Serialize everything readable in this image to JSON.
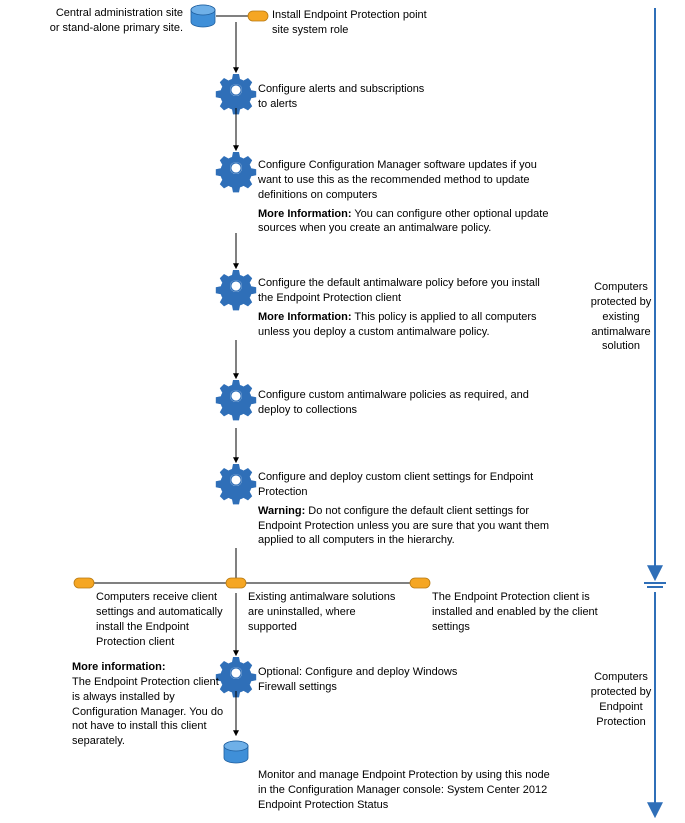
{
  "header": {
    "site_label": "Central administration site\nor stand-alone primary site."
  },
  "steps": {
    "install": "Install Endpoint Protection point site system role",
    "alerts": "Configure alerts and subscriptions to alerts",
    "updates_main": "Configure Configuration Manager software updates if you want to use this as the recommended method to update definitions on computers",
    "updates_more_label": "More Information:",
    "updates_more_text": " You can configure other optional update sources when you create an antimalware policy.",
    "default_policy_main": "Configure the default antimalware policy before you install the Endpoint Protection client",
    "default_policy_more_label": "More Information:",
    "default_policy_more_text": " This policy is applied to all computers unless you deploy a custom antimalware policy.",
    "custom_policies": "Configure custom antimalware policies as required, and deploy to collections",
    "client_settings_main": "Configure and deploy custom client settings for Endpoint Protection",
    "client_settings_warn_label": "Warning:",
    "client_settings_warn_text": " Do not configure the default client settings for Endpoint Protection unless you are sure that you want them applied to all computers in the hierarchy.",
    "branch_left": "Computers receive client settings and automatically install the Endpoint Protection client",
    "branch_mid": "Existing antimalware solutions are uninstalled, where supported",
    "branch_right": "The Endpoint Protection client is installed and enabled by the client settings",
    "more_info_label": "More information:",
    "more_info_text": "The Endpoint Protection client is always installed by Configuration Manager. You do not have to install this client separately.",
    "firewall": "Optional: Configure and deploy Windows Firewall settings",
    "monitor": "Monitor and manage Endpoint Protection by using this node in the Configuration Manager console: System Center 2012 Endpoint Protection Status"
  },
  "sidebar": {
    "top": "Computers protected by existing antimalware solution",
    "bottom": "Computers protected by Endpoint Protection"
  }
}
